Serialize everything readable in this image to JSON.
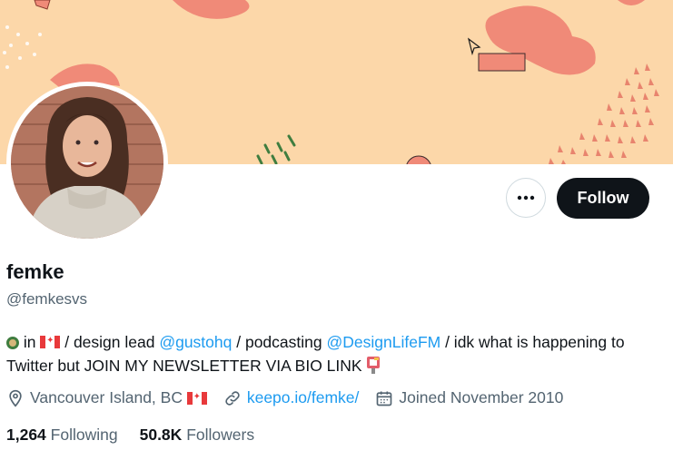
{
  "profile": {
    "name": "femke",
    "handle": "@femkesvs",
    "bio": {
      "in_text": " in ",
      "design_lead_text": " / design lead ",
      "gusto_mention": "@gustohq",
      "podcasting_text": " / podcasting ",
      "designlife_mention": "@DesignLifeFM",
      "idk_text": " / idk what is happening to Twitter but JOIN MY NEWSLETTER VIA BIO LINK "
    },
    "location": "Vancouver Island, BC",
    "website": "keepo.io/femke/",
    "joined": "Joined November 2010",
    "following_count": "1,264",
    "following_label": "Following",
    "followers_count": "50.8K",
    "followers_label": "Followers"
  },
  "actions": {
    "follow_label": "Follow",
    "more_label": "More"
  },
  "colors": {
    "banner": "#fcd7a9",
    "accent_link": "#1d9bf0",
    "secondary_text": "#536471",
    "follow_button": "#0f1419"
  },
  "icons": {
    "location": "location-pin-icon",
    "link": "link-icon",
    "calendar": "calendar-icon",
    "more": "more-dots-icon"
  }
}
